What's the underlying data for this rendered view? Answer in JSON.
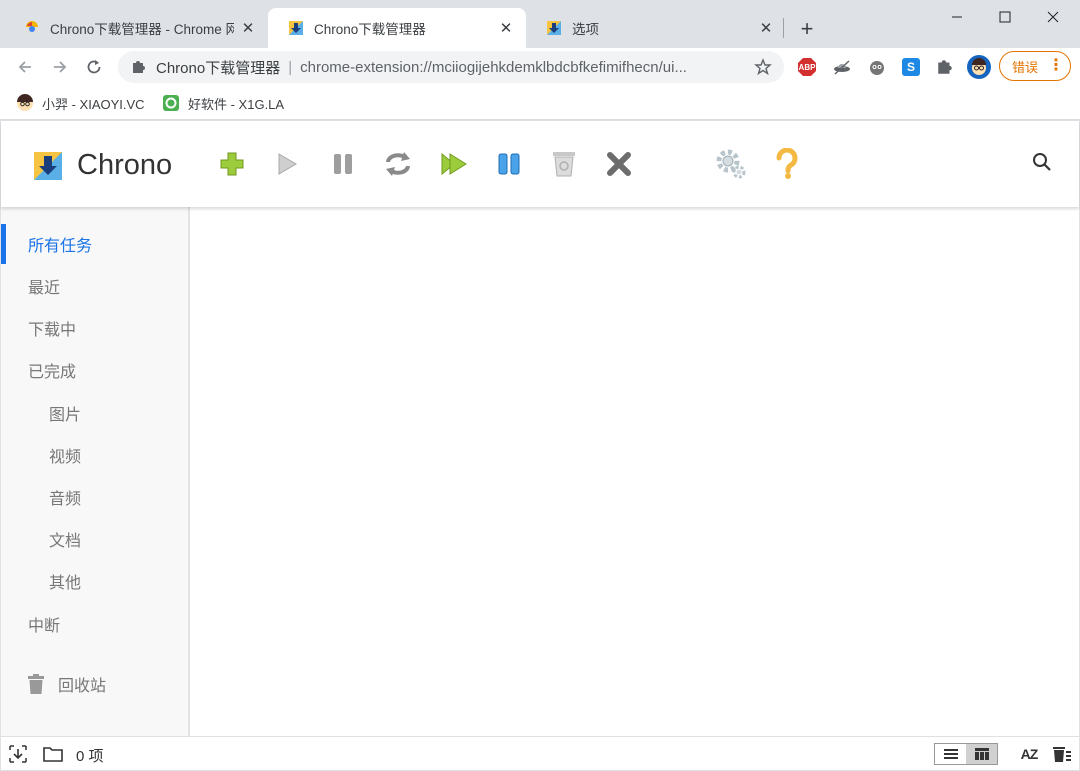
{
  "tabs": [
    {
      "title": "Chrono下载管理器 - Chrome 网",
      "favicon": "chrome-webstore-icon",
      "active": false
    },
    {
      "title": "Chrono下载管理器",
      "favicon": "chrono-download-icon",
      "active": true
    },
    {
      "title": "选项",
      "favicon": "chrono-download-icon",
      "active": false
    }
  ],
  "omnibox": {
    "site_name": "Chrono下载管理器",
    "separator": "|",
    "url": "chrome-extension://mciiogijehkdemklbdcbfkefimifhecn/ui..."
  },
  "extensions": {
    "abp_label": "ABP",
    "s_label": "S",
    "error_label": "错误"
  },
  "bookmarks": [
    {
      "label": "小羿 - XIAOYI.VC",
      "icon": "avatar-icon"
    },
    {
      "label": "好软件 - X1G.LA",
      "icon": "software-icon"
    }
  ],
  "app": {
    "brand": "Chrono",
    "toolbar": [
      "add-icon",
      "play-icon",
      "pause-icon",
      "refresh-icon",
      "play-all-icon",
      "pause-all-icon",
      "trash-bin-icon",
      "delete-icon",
      "settings-icon",
      "help-icon"
    ]
  },
  "sidebar": {
    "items": [
      {
        "label": "所有任务",
        "active": true,
        "sub": false
      },
      {
        "label": "最近",
        "active": false,
        "sub": false
      },
      {
        "label": "下载中",
        "active": false,
        "sub": false
      },
      {
        "label": "已完成",
        "active": false,
        "sub": false
      },
      {
        "label": "图片",
        "active": false,
        "sub": true
      },
      {
        "label": "视频",
        "active": false,
        "sub": true
      },
      {
        "label": "音频",
        "active": false,
        "sub": true
      },
      {
        "label": "文档",
        "active": false,
        "sub": true
      },
      {
        "label": "其他",
        "active": false,
        "sub": true
      },
      {
        "label": "中断",
        "active": false,
        "sub": false
      }
    ],
    "trash_label": "回收站"
  },
  "status": {
    "count_text": "0 项",
    "sort_label": "AZ"
  },
  "colors": {
    "accent": "#1a73e8",
    "error": "#e37400"
  }
}
